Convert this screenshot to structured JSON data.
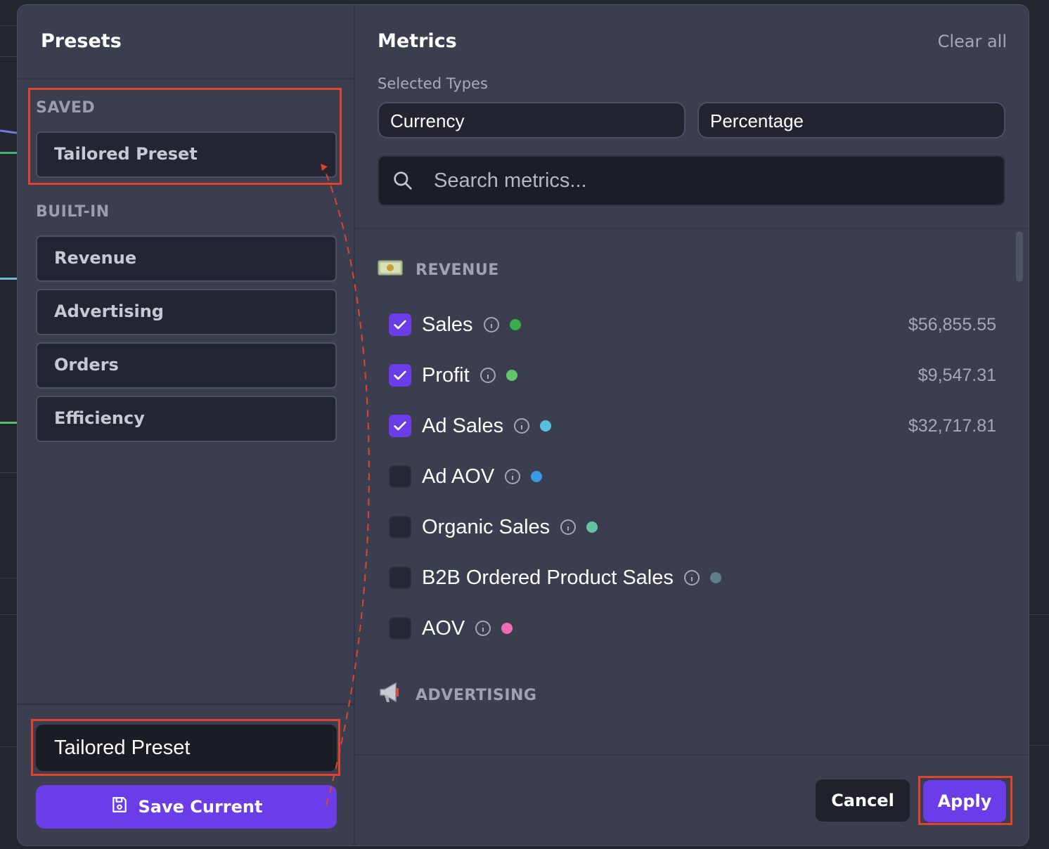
{
  "presets": {
    "title": "Presets",
    "saved_label": "SAVED",
    "saved_items": [
      {
        "label": "Tailored Preset"
      }
    ],
    "builtin_label": "BUILT-IN",
    "builtin_items": [
      {
        "label": "Revenue"
      },
      {
        "label": "Advertising"
      },
      {
        "label": "Orders"
      },
      {
        "label": "Efficiency"
      }
    ],
    "name_input_value": "Tailored Preset",
    "save_label": "Save Current"
  },
  "metrics": {
    "title": "Metrics",
    "clear_all": "Clear all",
    "selected_types_label": "Selected Types",
    "selected_types": [
      "Currency",
      "Percentage"
    ],
    "search_placeholder": "Search metrics...",
    "categories": [
      {
        "icon": "money-icon",
        "label": "REVENUE",
        "items": [
          {
            "name": "Sales",
            "checked": true,
            "color": "#3aae4f",
            "value": "$56,855.55"
          },
          {
            "name": "Profit",
            "checked": true,
            "color": "#63c66a",
            "value": "$9,547.31"
          },
          {
            "name": "Ad Sales",
            "checked": true,
            "color": "#5bc0de",
            "value": "$32,717.81"
          },
          {
            "name": "Ad AOV",
            "checked": false,
            "color": "#3b9be8",
            "value": ""
          },
          {
            "name": "Organic Sales",
            "checked": false,
            "color": "#66c2a5",
            "value": ""
          },
          {
            "name": "B2B Ordered Product Sales",
            "checked": false,
            "color": "#607d8b",
            "value": ""
          },
          {
            "name": "AOV",
            "checked": false,
            "color": "#f06bb0",
            "value": ""
          }
        ]
      },
      {
        "icon": "megaphone-icon",
        "label": "ADVERTISING",
        "items": []
      }
    ]
  },
  "footer": {
    "cancel_label": "Cancel",
    "apply_label": "Apply"
  },
  "colors": {
    "accent": "#6a3de8",
    "highlight": "#e0442c"
  }
}
